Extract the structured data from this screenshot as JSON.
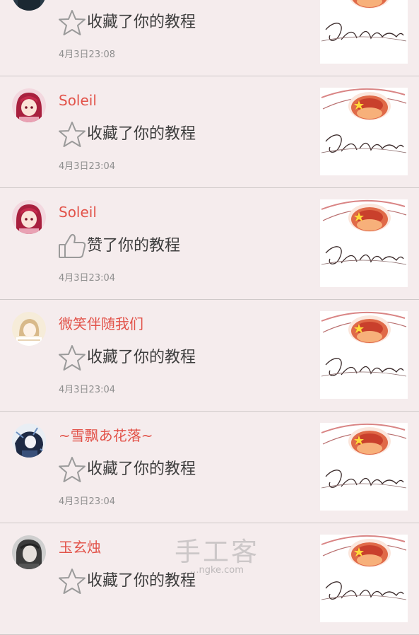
{
  "colors": {
    "background": "#f5eced",
    "username": "#e2534a",
    "action_text": "#3d3d3d",
    "timestamp": "#8f8f8f",
    "divider": "#cfc9c9"
  },
  "notifications": [
    {
      "username": "",
      "action_icon": "star-icon",
      "action": "收藏了你的教程",
      "time": "4月3日23:08",
      "avatar": "avatar-dark-icon",
      "thumbnail_text": "China"
    },
    {
      "username": "Soleil",
      "action_icon": "star-icon",
      "action": "收藏了你的教程",
      "time": "4月3日23:04",
      "avatar": "avatar-anime-red-icon",
      "thumbnail_text": "China"
    },
    {
      "username": "Soleil",
      "action_icon": "thumbs-up-icon",
      "action": "赞了你的教程",
      "time": "4月3日23:04",
      "avatar": "avatar-anime-red-icon",
      "thumbnail_text": "China"
    },
    {
      "username": "微笑伴随我们",
      "action_icon": "star-icon",
      "action": "收藏了你的教程",
      "time": "4月3日23:04",
      "avatar": "avatar-light-icon",
      "thumbnail_text": "China"
    },
    {
      "username": "~雪飘あ花落~",
      "action_icon": "star-icon",
      "action": "收藏了你的教程",
      "time": "4月3日23:04",
      "avatar": "avatar-blue-icon",
      "thumbnail_text": "China"
    },
    {
      "username": "玉玄烛",
      "action_icon": "star-icon",
      "action": "收藏了你的教程",
      "time": "",
      "avatar": "avatar-gray-icon",
      "thumbnail_text": "China"
    }
  ],
  "watermark": {
    "main": "手工客",
    "sub": "...ngke.com"
  }
}
